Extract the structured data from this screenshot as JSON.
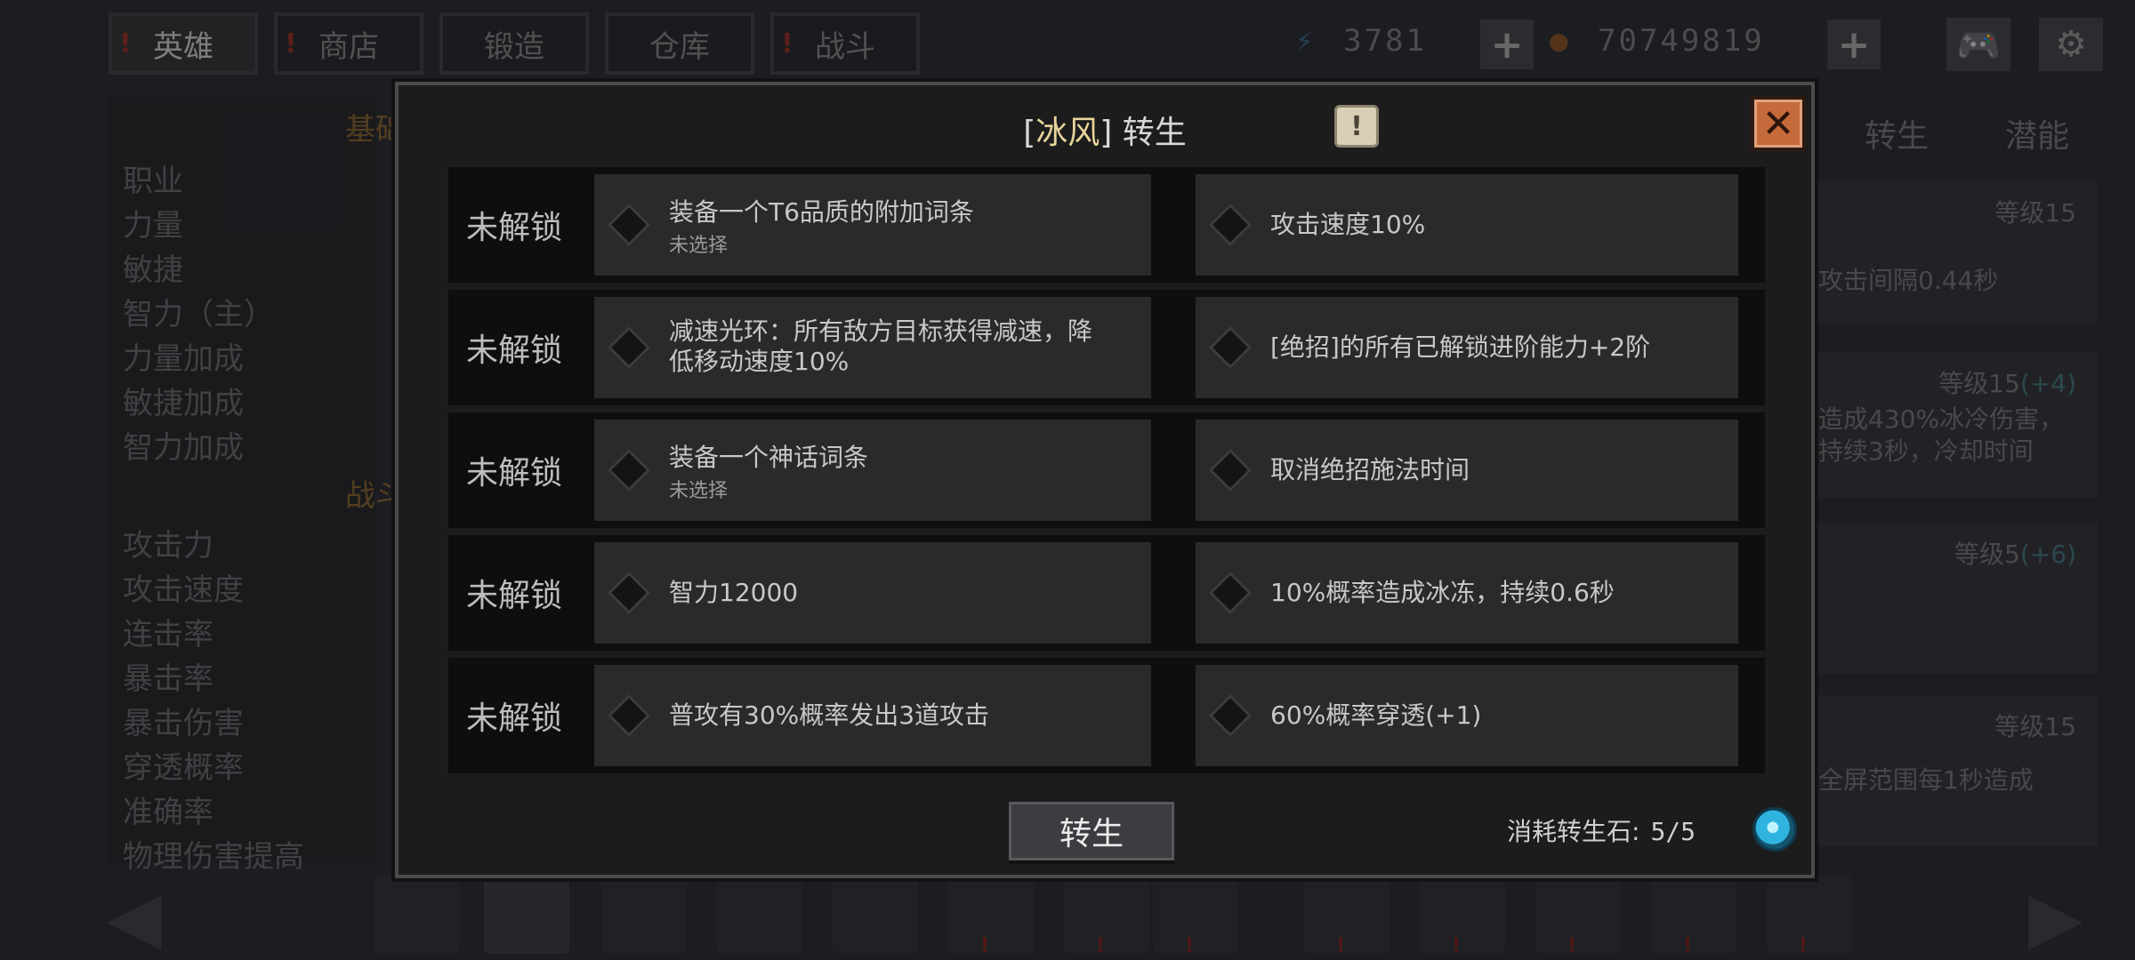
{
  "top_tabs": [
    {
      "label": "英雄",
      "warn": true,
      "active": true
    },
    {
      "label": "商店",
      "warn": true,
      "active": false
    },
    {
      "label": "锻造",
      "warn": false,
      "active": false
    },
    {
      "label": "仓库",
      "warn": false,
      "active": false
    },
    {
      "label": "战斗",
      "warn": true,
      "active": false
    }
  ],
  "resources": {
    "energy": "3781",
    "gold": "70749819"
  },
  "left_panel": {
    "section_basic": "基础",
    "stats_basic": [
      "职业",
      "力量",
      "敏捷",
      "智力（主）",
      "力量加成",
      "敏捷加成",
      "智力加成"
    ],
    "section_battle": "战斗",
    "stats_battle": [
      "攻击力",
      "攻击速度",
      "连击率",
      "暴击率",
      "暴击伤害",
      "穿透概率",
      "准确率",
      "物理伤害提高"
    ]
  },
  "right_panel": {
    "tabs": [
      "转生",
      "潜能"
    ],
    "cards": [
      {
        "level": "等级15",
        "plus": "",
        "lines": [
          "攻击间隔0.44秒"
        ]
      },
      {
        "level": "等级15",
        "plus": "(+4)",
        "lines": [
          "造成430%冰冷伤害，",
          "持续3秒，冷却时间"
        ]
      },
      {
        "level": "等级5",
        "plus": "(+6)",
        "lines": []
      },
      {
        "level": "等级15",
        "plus": "",
        "lines": [
          "全屏范围每1秒造成"
        ]
      }
    ]
  },
  "modal": {
    "title_prefix": "[",
    "title_name": "冰风",
    "title_suffix": "] 转生",
    "help_icon": "!",
    "close_icon": "✕",
    "rows": [
      {
        "lock": "未解锁",
        "left": "装备一个T6品质的附加词条",
        "left_sub": "未选择",
        "right": "攻击速度10%"
      },
      {
        "lock": "未解锁",
        "left": "减速光环：所有敌方目标获得减速，降\n低移动速度10%",
        "left_sub": "",
        "right": "[绝招]的所有已解锁进阶能力+2阶"
      },
      {
        "lock": "未解锁",
        "left": "装备一个神话词条",
        "left_sub": "未选择",
        "right": "取消绝招施法时间"
      },
      {
        "lock": "未解锁",
        "left": "智力12000",
        "left_sub": "",
        "right": "10%概率造成冰冻，持续0.6秒"
      },
      {
        "lock": "未解锁",
        "left": "普攻有30%概率发出3道攻击",
        "left_sub": "",
        "right": "60%概率穿透(+1)"
      }
    ],
    "rebirth_button": "转生",
    "cost_label": "消耗转生石:",
    "cost_value": "5/5"
  },
  "colors": {
    "accent_title": "#e8d59a",
    "close_button": "#c56a3a",
    "warn": "#8a2a22",
    "stone": "#2fb4e0"
  }
}
